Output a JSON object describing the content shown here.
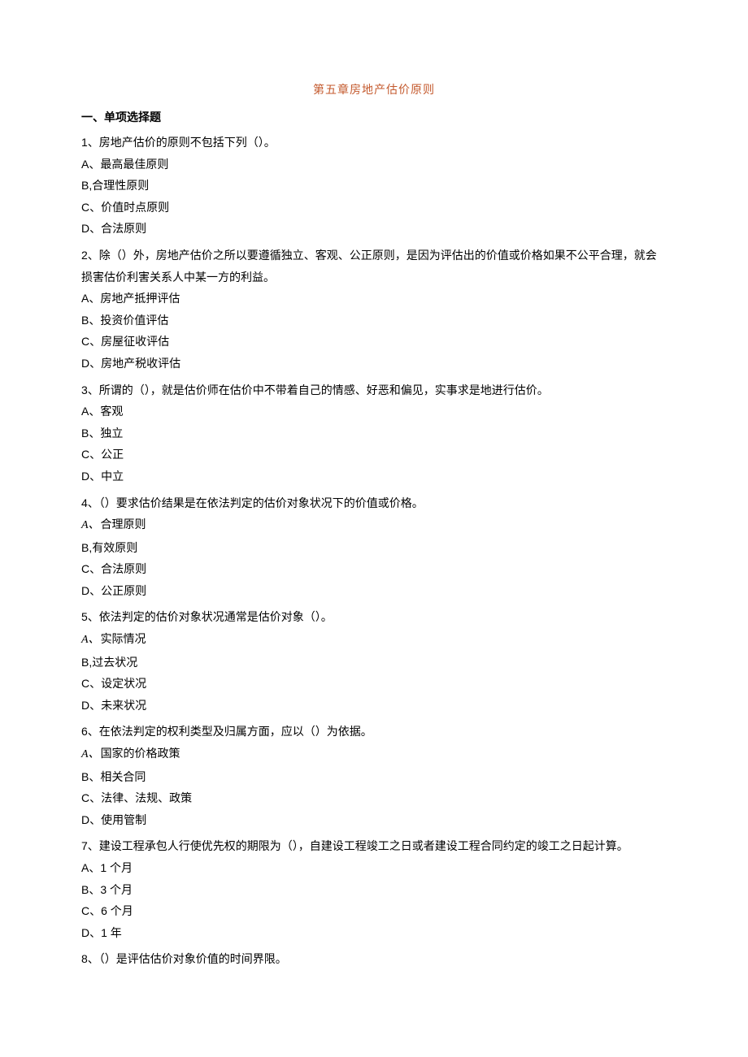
{
  "title": "第五章房地产估价原则",
  "section_heading": "一、单项选择题",
  "questions": [
    {
      "stem": "1、房地产估价的原则不包括下列（）。",
      "options": [
        {
          "letter": "A、",
          "text": "最高最佳原则",
          "style": "plain"
        },
        {
          "letter": "B,",
          "text": "合理性原则",
          "style": "plain"
        },
        {
          "letter": "C、",
          "text": "价值时点原则",
          "style": "plain"
        },
        {
          "letter": "D、",
          "text": "合法原则",
          "style": "plain"
        }
      ]
    },
    {
      "stem": "2、除（）外，房地产估价之所以要遵循独立、客观、公正原则，是因为评估出的价值或价格如果不公平合理，就会损害估价利害关系人中某一方的利益。",
      "options": [
        {
          "letter": "A、",
          "text": "房地产抵押评估",
          "style": "plain"
        },
        {
          "letter": "B、",
          "text": "投资价值评估",
          "style": "plain"
        },
        {
          "letter": "C、",
          "text": "房屋征收评估",
          "style": "plain"
        },
        {
          "letter": "D、",
          "text": "房地产税收评估",
          "style": "plain"
        }
      ]
    },
    {
      "stem": "3、所谓的（），就是估价师在估价中不带着自己的情感、好恶和偏见，实事求是地进行估价。",
      "options": [
        {
          "letter": "A、",
          "text": "客观",
          "style": "plain"
        },
        {
          "letter": "B、",
          "text": "独立",
          "style": "plain"
        },
        {
          "letter": "C、",
          "text": "公正",
          "style": "plain"
        },
        {
          "letter": "D、",
          "text": "中立",
          "style": "plain"
        }
      ]
    },
    {
      "stem": "4、（）要求估价结果是在依法判定的估价对象状况下的价值或价格。",
      "options": [
        {
          "letter": "A、",
          "text": "合理原则",
          "style": "italic"
        },
        {
          "letter": "B,",
          "text": "有效原则",
          "style": "plain"
        },
        {
          "letter": "C、",
          "text": "合法原则",
          "style": "plain"
        },
        {
          "letter": "D、",
          "text": "公正原则",
          "style": "plain"
        }
      ]
    },
    {
      "stem": "5、依法判定的估价对象状况通常是估价对象（）。",
      "options": [
        {
          "letter": "A、",
          "text": "实际情况",
          "style": "italic"
        },
        {
          "letter": "B,",
          "text": "过去状况",
          "style": "plain"
        },
        {
          "letter": "C、",
          "text": "设定状况",
          "style": "plain"
        },
        {
          "letter": "D、",
          "text": "未来状况",
          "style": "plain"
        }
      ]
    },
    {
      "stem": "6、在依法判定的权利类型及归属方面，应以（）为依据。",
      "options": [
        {
          "letter": "A、",
          "text": "国家的价格政策",
          "style": "italic"
        },
        {
          "letter": "B、",
          "text": "相关合同",
          "style": "plain"
        },
        {
          "letter": "C、",
          "text": "法律、法规、政策",
          "style": "plain"
        },
        {
          "letter": "D、",
          "text": "使用管制",
          "style": "plain"
        }
      ]
    },
    {
      "stem": "7、建设工程承包人行使优先权的期限为（），自建设工程竣工之日或者建设工程合同约定的竣工之日起计算。",
      "options": [
        {
          "letter": "A、",
          "text": "1 个月",
          "style": "plain"
        },
        {
          "letter": "B、",
          "text": "3 个月",
          "style": "plain"
        },
        {
          "letter": "C、",
          "text": "6 个月",
          "style": "plain"
        },
        {
          "letter": "D、",
          "text": "1 年",
          "style": "plain"
        }
      ]
    },
    {
      "stem": "8、（）是评估估价对象价值的时间界限。",
      "options": []
    }
  ]
}
